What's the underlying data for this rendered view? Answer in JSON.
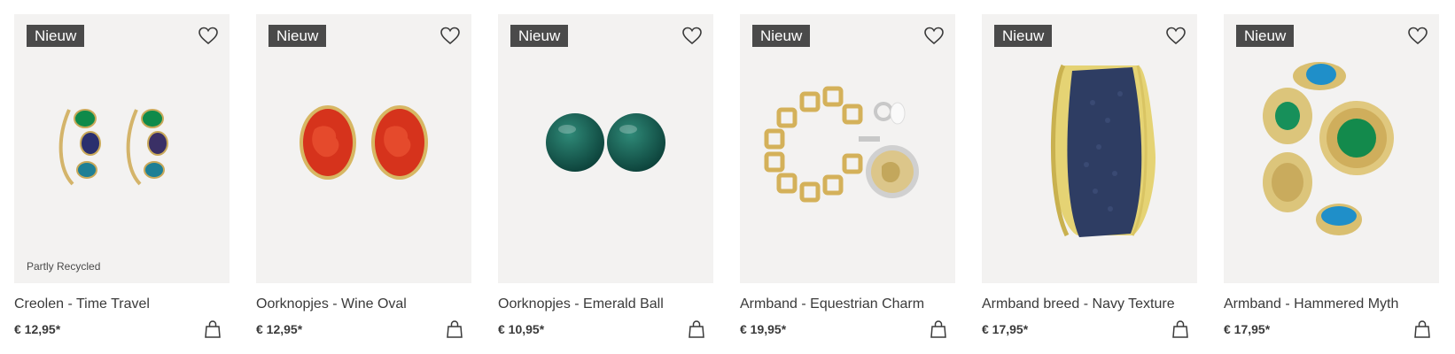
{
  "products": [
    {
      "badge": "Nieuw",
      "tag": "Partly Recycled",
      "name": "Creolen - Time Travel",
      "price": "€ 12,95*",
      "image": "hoop-earrings-gems"
    },
    {
      "badge": "Nieuw",
      "tag": "",
      "name": "Oorknopjes - Wine Oval",
      "price": "€ 12,95*",
      "image": "red-oval-studs"
    },
    {
      "badge": "Nieuw",
      "tag": "",
      "name": "Oorknopjes - Emerald Ball",
      "price": "€ 10,95*",
      "image": "green-ball-studs"
    },
    {
      "badge": "Nieuw",
      "tag": "",
      "name": "Armband - Equestrian Charm",
      "price": "€ 19,95*",
      "image": "gold-chain-coin-bracelet"
    },
    {
      "badge": "Nieuw",
      "tag": "",
      "name": "Armband breed - Navy Texture",
      "price": "€ 17,95*",
      "image": "navy-cuff-bracelet"
    },
    {
      "badge": "Nieuw",
      "tag": "",
      "name": "Armband - Hammered Myth",
      "price": "€ 17,95*",
      "image": "gold-stone-bracelet"
    }
  ],
  "icons": {
    "wishlist": "heart-icon",
    "cart": "shopping-bag-icon"
  },
  "colors": {
    "card_bg": "#f3f2f1",
    "badge_bg": "#4a4a4a",
    "text": "#3a3a3a"
  }
}
